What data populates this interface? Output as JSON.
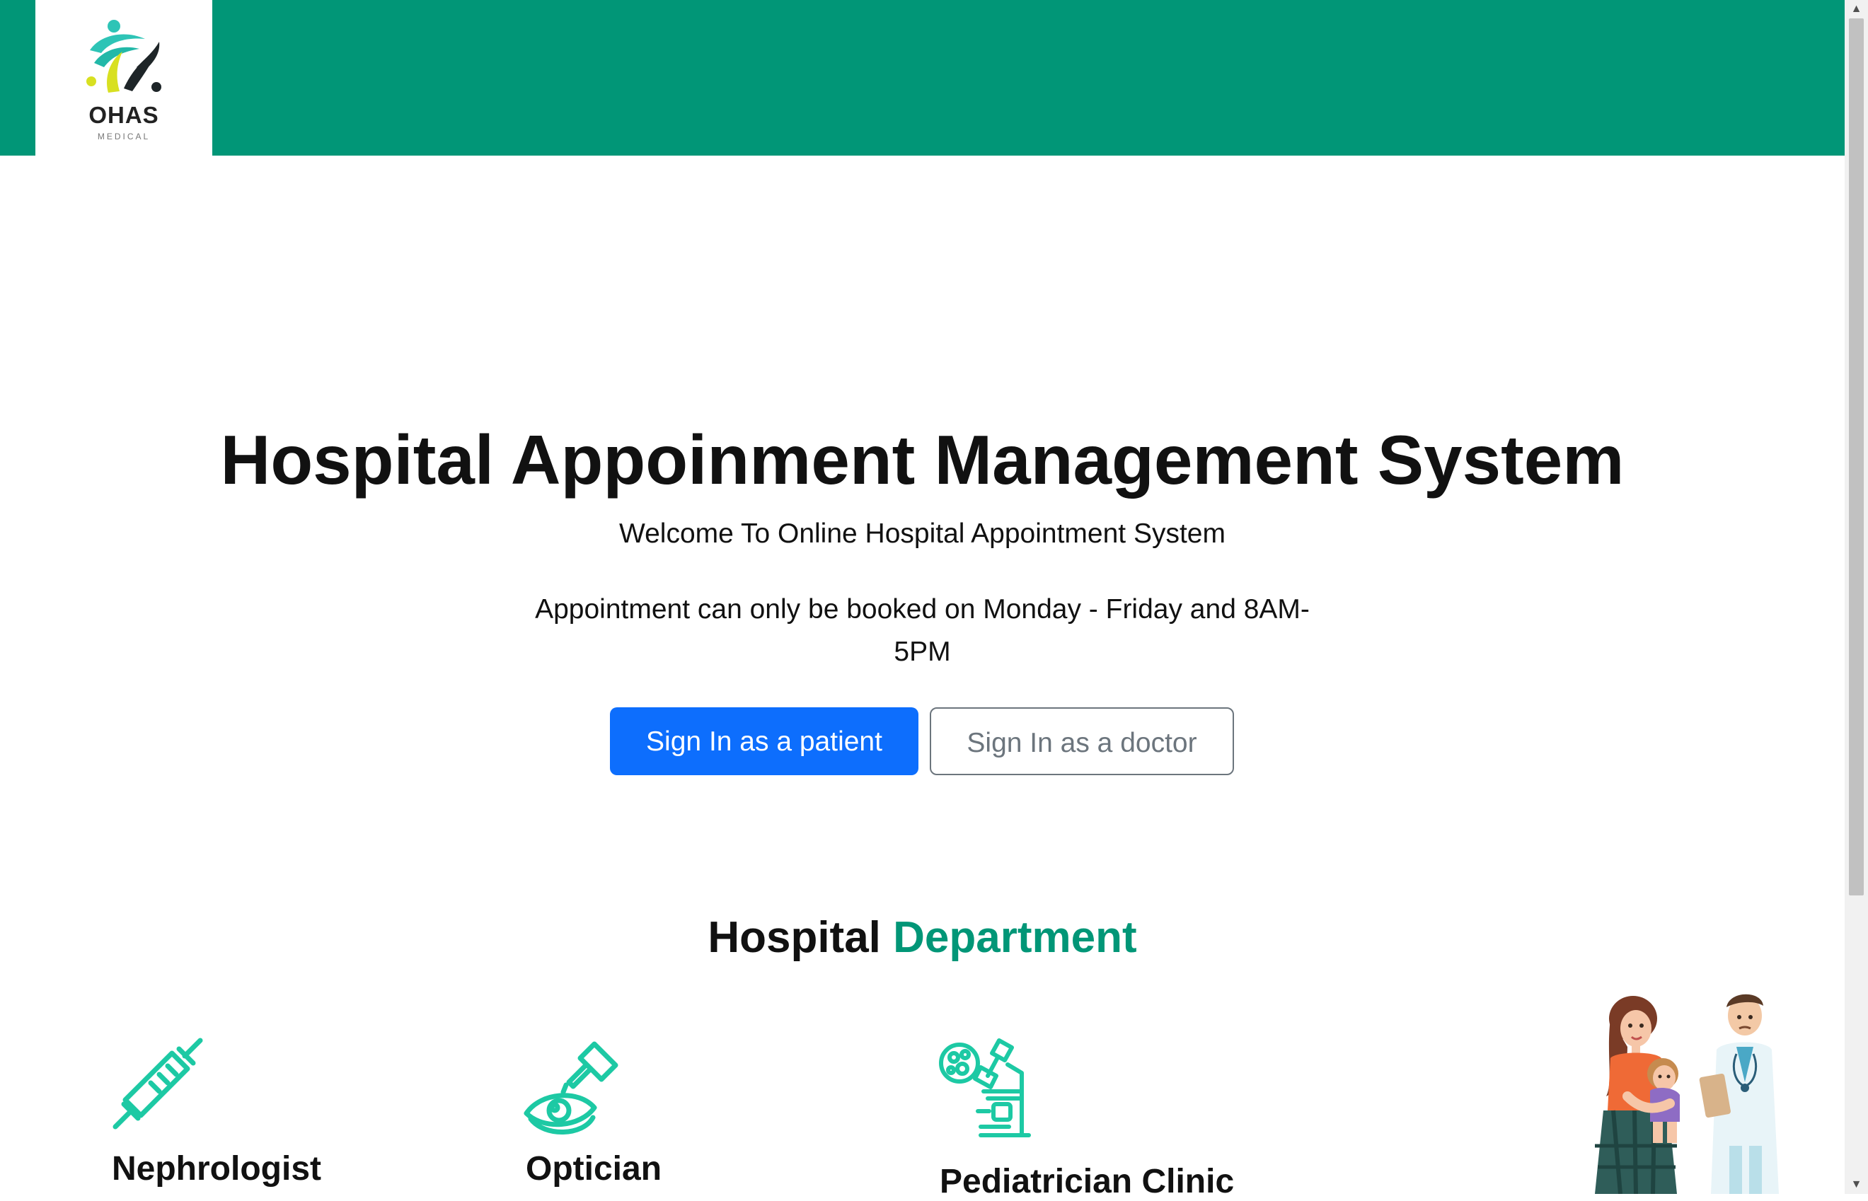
{
  "header": {
    "logo_text": "OHAS",
    "logo_subtext": "MEDICAL"
  },
  "hero": {
    "title": "Hospital Appoinment Management System",
    "subtitle": "Welcome To Online Hospital Appointment System",
    "note": "Appointment can only be booked on Monday - Friday and 8AM-5PM"
  },
  "buttons": {
    "patient": "Sign In as a patient",
    "doctor": "Sign In as a doctor"
  },
  "departments_section": {
    "title_plain": "Hospital",
    "title_accent": "Department",
    "accent_color": "#019677",
    "items": [
      {
        "name": "Nephrologist",
        "icon": "syringe-icon"
      },
      {
        "name": "Optician",
        "icon": "eye-drops-icon"
      },
      {
        "name": "Pediatrician Clinic",
        "icon": "microscope-icon"
      }
    ]
  },
  "colors": {
    "header_green": "#019677",
    "primary_blue": "#0d6efd",
    "secondary_gray": "#6c757d"
  }
}
